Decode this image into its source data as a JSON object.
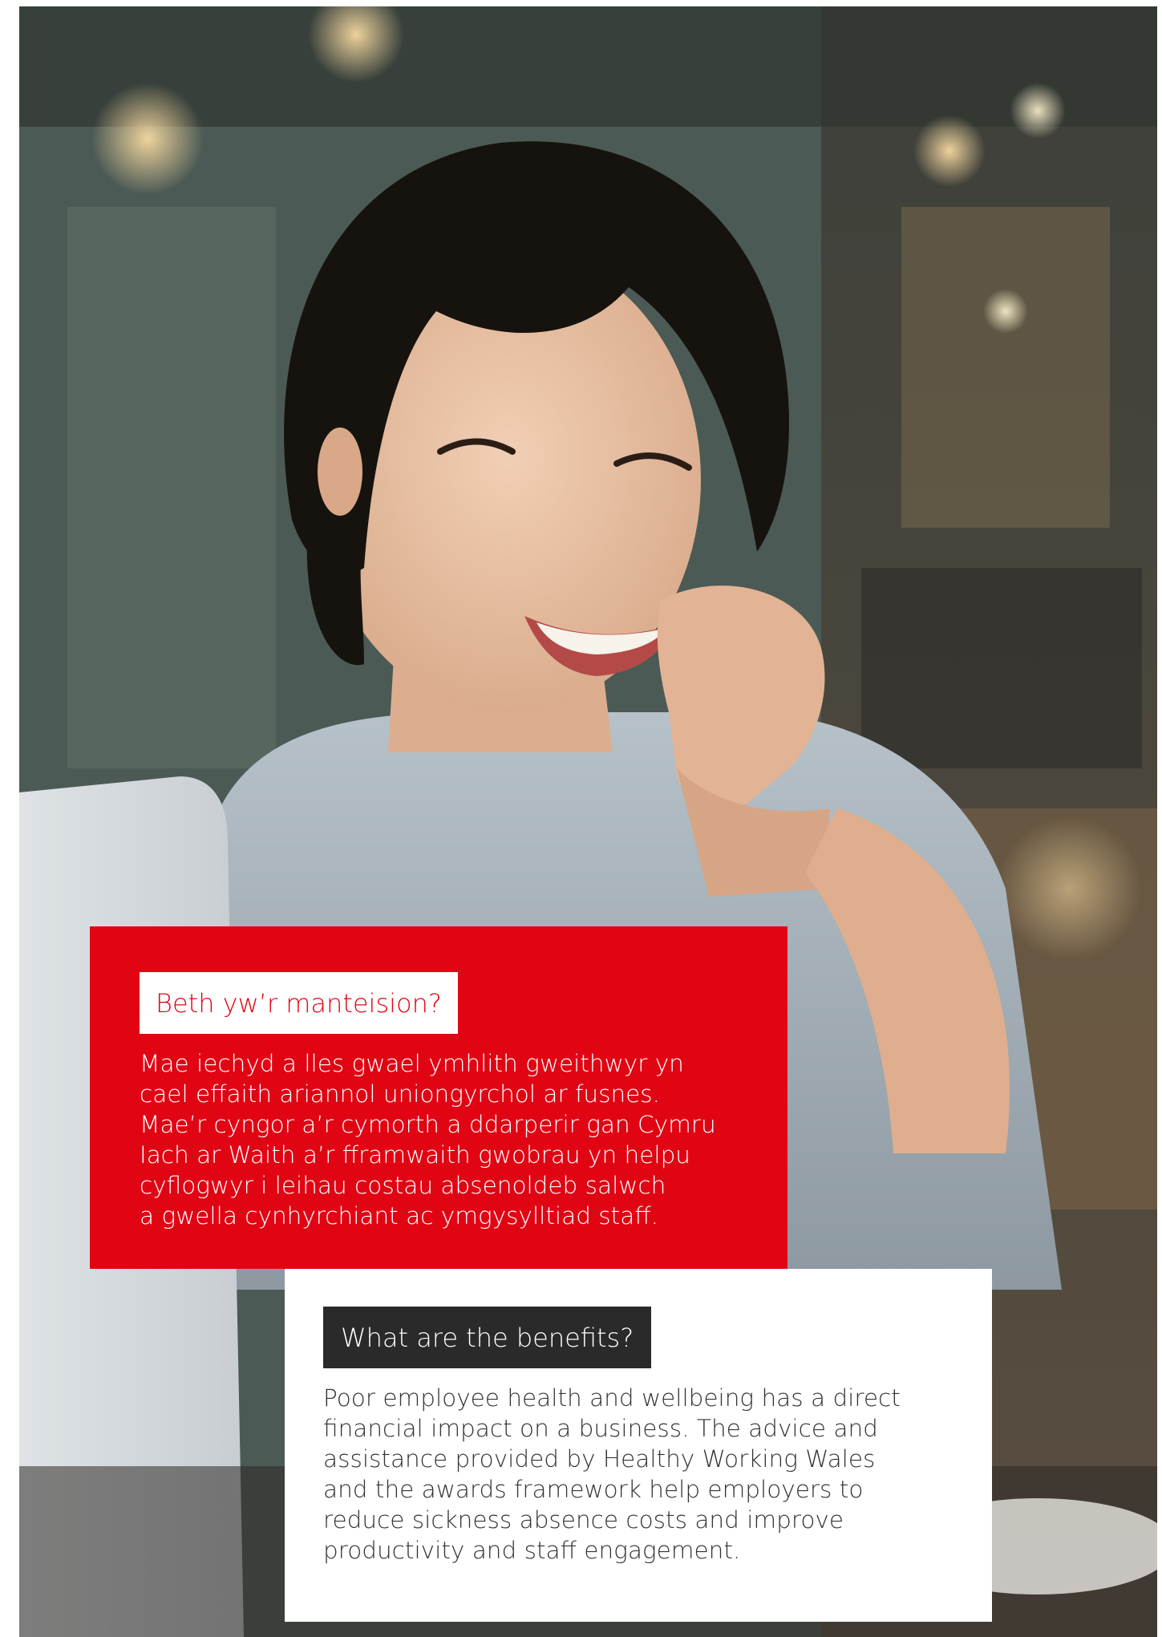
{
  "photo": {
    "subject": "smiling-woman-cafe-photo"
  },
  "welsh_panel": {
    "heading": "Beth yw’r manteision?",
    "body_lines": [
      "Mae iechyd a lles gwael ymhlith gweithwyr yn",
      "cael effaith ariannol uniongyrchol ar fusnes.",
      "Mae’r cyngor a’r cymorth a ddarperir gan Cymru",
      "Iach ar Waith a’r fframwaith gwobrau yn helpu",
      "cyflogwyr i leihau costau absenoldeb salwch",
      "a gwella cynhyrchiant ac ymgysylltiad staff."
    ],
    "background_color": "#e10514"
  },
  "english_panel": {
    "heading": "What are the benefits?",
    "body_lines": [
      "Poor employee health and wellbeing has a direct",
      "financial impact on a business. The advice and",
      "assistance provided by Healthy Working Wales",
      "and the awards framework help employers to",
      "reduce sickness absence costs and improve",
      "productivity and staff engagement."
    ],
    "heading_background_color": "#2a2a2a"
  }
}
